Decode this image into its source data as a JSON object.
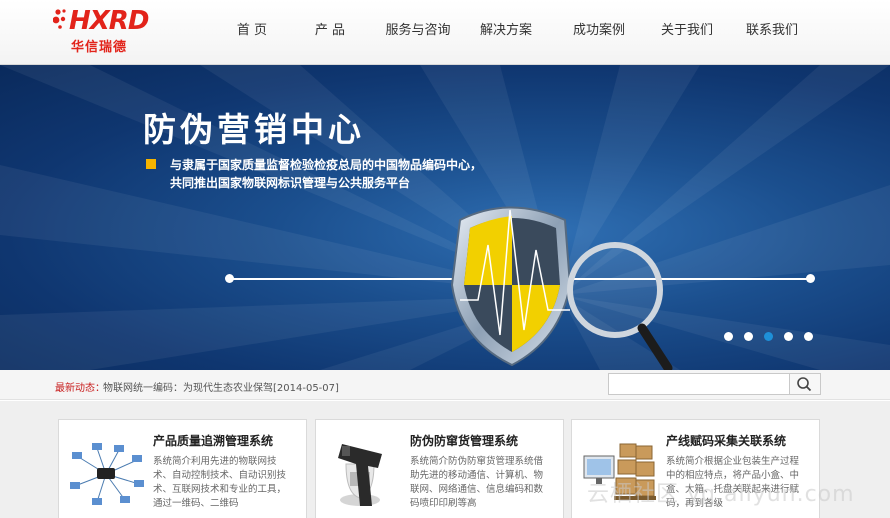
{
  "brand": {
    "logo_mark": "HXRD",
    "logo_text": "华信瑞德",
    "color": "#e2231a"
  },
  "nav": {
    "items": [
      {
        "label": "首 页",
        "width": 68
      },
      {
        "label": "产 品",
        "width": 88
      },
      {
        "label": "服务与咨询",
        "width": 88
      },
      {
        "label": "解决方案",
        "width": 88
      },
      {
        "label": "成功案例",
        "width": 98
      },
      {
        "label": "关于我们",
        "width": 78
      },
      {
        "label": "联系我们",
        "width": 92
      }
    ]
  },
  "banner": {
    "title": "防伪营销中心",
    "subtitle_line1": "与隶属于国家质量监督检验检疫总局的中国物品编码中心，",
    "subtitle_line2": "共同推出国家物联网标识管理与公共服务平台",
    "slides": 5,
    "active_slide": 3,
    "accent": "#f5b400",
    "active_dot_color": "#1e90d8"
  },
  "news": {
    "label": "最新动态：",
    "text": "物联网统一编码：为现代生态农业保驾[2014-05-07]",
    "search_placeholder": ""
  },
  "products": [
    {
      "title": "产品质量追溯管理系统",
      "desc": "系统简介利用先进的物联网技术、自动控制技术、自动识别技术、互联网技术和专业的工具，通过一维码、二维码",
      "icon": "network-diagram-icon"
    },
    {
      "title": "防伪防窜货管理系统",
      "desc": "系统简介防伪防窜货管理系统借助先进的移动通信、计算机、物联网、网络通信、信息编码和数码喷印印刷等高",
      "icon": "barcode-scanner-icon"
    },
    {
      "title": "产线赋码采集关联系统",
      "desc": "系统简介根据企业包装生产过程中的相应特点，将产品小盒、中盒、大箱、托盘关联起来进行赋码，再到各级",
      "icon": "boxes-monitor-icon"
    }
  ],
  "watermark": "云栖社区 yq.aliyun.com"
}
